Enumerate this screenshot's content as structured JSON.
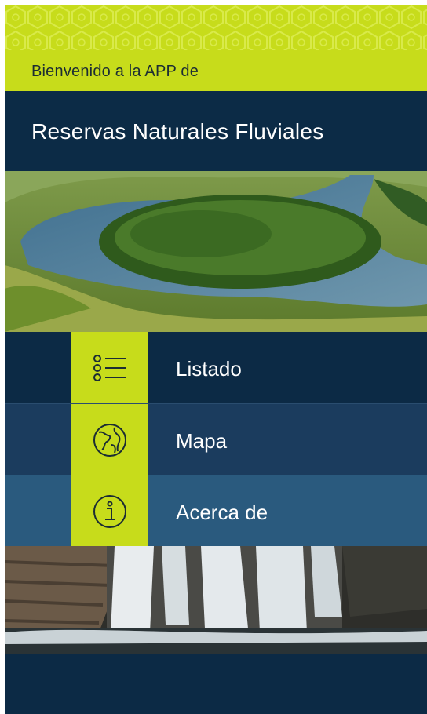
{
  "header": {
    "welcome_text": "Bienvenido a la APP de",
    "title": "Reservas Naturales Fluviales"
  },
  "menu": {
    "items": [
      {
        "label": "Listado",
        "icon": "list-icon"
      },
      {
        "label": "Mapa",
        "icon": "globe-icon"
      },
      {
        "label": "Acerca de",
        "icon": "info-icon"
      }
    ]
  },
  "colors": {
    "accent": "#c7dc1b",
    "navy": "#0c2a45",
    "row2": "#1b3c5e",
    "row3": "#2a5a7e"
  }
}
